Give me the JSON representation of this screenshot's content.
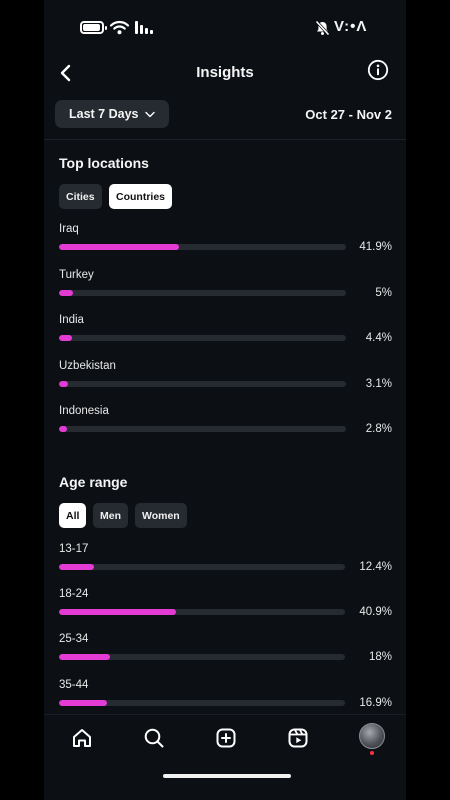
{
  "status_bar": {
    "time": "V:•Λ"
  },
  "header": {
    "title": "Insights"
  },
  "date_filter": {
    "range_label": "Last 7 Days",
    "date_range": "Oct 27 - Nov 2"
  },
  "top_locations": {
    "title": "Top locations",
    "tabs": [
      {
        "label": "Cities",
        "active": false
      },
      {
        "label": "Countries",
        "active": true
      }
    ],
    "items": [
      {
        "label": "Iraq",
        "percent_text": "41.9%",
        "fraction": 0.419
      },
      {
        "label": "Turkey",
        "percent_text": "5%",
        "fraction": 0.05
      },
      {
        "label": "India",
        "percent_text": "4.4%",
        "fraction": 0.044
      },
      {
        "label": "Uzbekistan",
        "percent_text": "3.1%",
        "fraction": 0.031
      },
      {
        "label": "Indonesia",
        "percent_text": "2.8%",
        "fraction": 0.028
      }
    ]
  },
  "age_range": {
    "title": "Age range",
    "tabs": [
      {
        "label": "All",
        "active": true
      },
      {
        "label": "Men",
        "active": false
      },
      {
        "label": "Women",
        "active": false
      }
    ],
    "items": [
      {
        "label": "13-17",
        "percent_text": "12.4%",
        "fraction": 0.124
      },
      {
        "label": "18-24",
        "percent_text": "40.9%",
        "fraction": 0.409
      },
      {
        "label": "25-34",
        "percent_text": "18%",
        "fraction": 0.18
      },
      {
        "label": "35-44",
        "percent_text": "16.9%",
        "fraction": 0.169
      }
    ]
  },
  "tab_bar": {
    "icons": [
      "home-icon",
      "search-icon",
      "create-icon",
      "reels-icon",
      "profile-avatar"
    ]
  },
  "colors": {
    "accent": "#e43bd5",
    "background": "#0c0f14",
    "track": "#262a31",
    "chip": "#262a31"
  }
}
